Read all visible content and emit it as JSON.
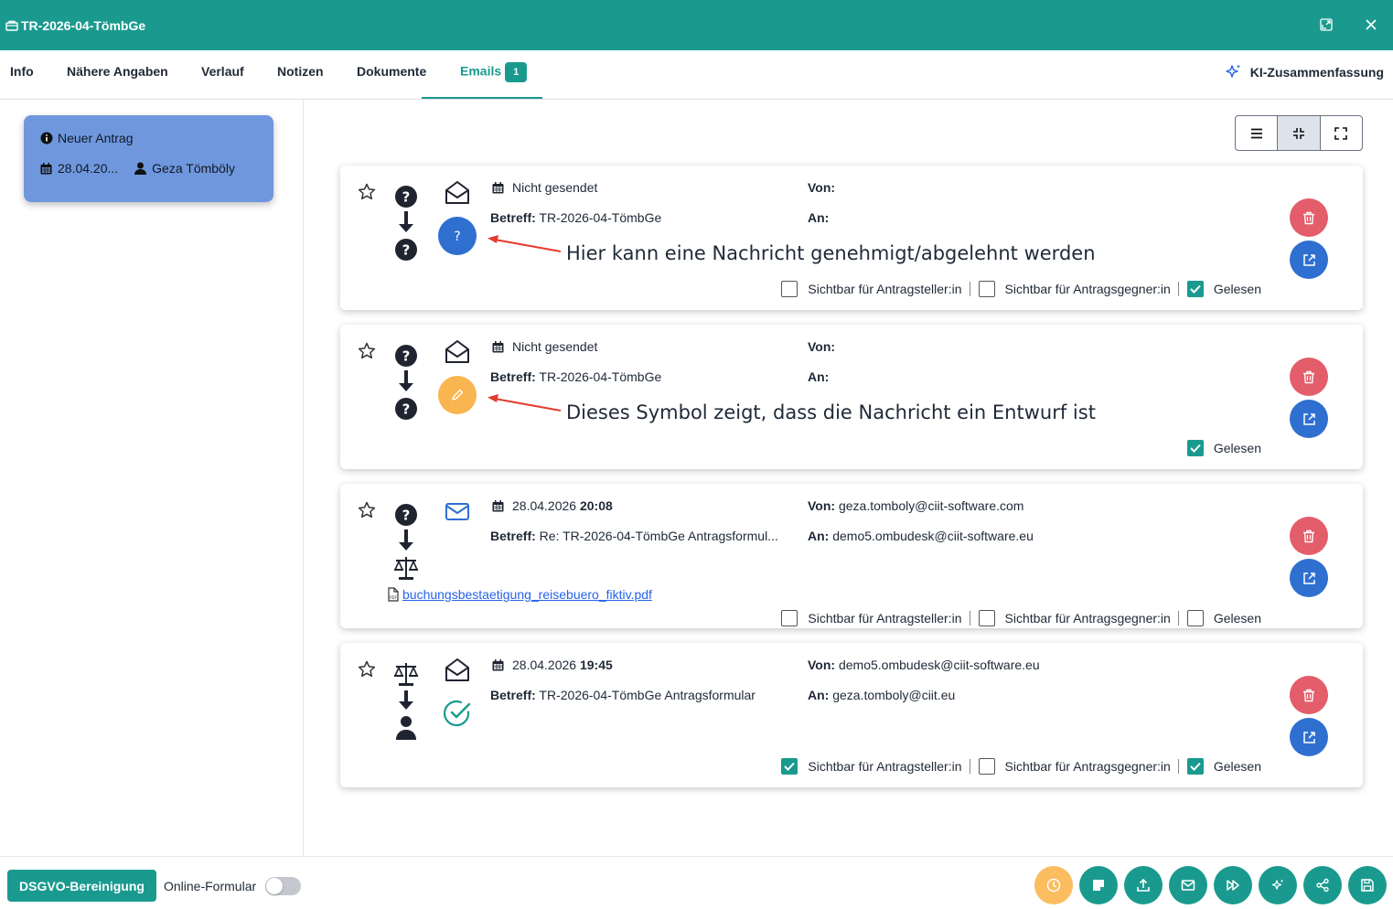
{
  "window": {
    "title": "TR-2026-04-TömbGe"
  },
  "tabs": [
    {
      "label": "Info"
    },
    {
      "label": "Nähere Angaben"
    },
    {
      "label": "Verlauf"
    },
    {
      "label": "Notizen"
    },
    {
      "label": "Dokumente"
    },
    {
      "label": "Emails",
      "badge": "1",
      "active": true
    }
  ],
  "ki_summary": {
    "label": "KI-Zusammenfassung"
  },
  "antrag_card": {
    "status": "Neuer Antrag",
    "date": "28.04.20...",
    "user": "Geza Tömböly"
  },
  "labels": {
    "betreff": "Betreff:",
    "von": "Von:",
    "an": "An:",
    "sichtbar_antragsteller": "Sichtbar für Antragsteller:in",
    "sichtbar_antragsgegner": "Sichtbar für Antragsgegner:in",
    "gelesen": "Gelesen"
  },
  "emails": [
    {
      "date": "Nicht gesendet",
      "time": "",
      "subject": "TR-2026-04-TömbGe",
      "from": "",
      "to": "",
      "status": "pending-approval",
      "annotation": "Hier kann eine Nachricht genehmigt/abgelehnt werden",
      "sichtbar_antragsteller": false,
      "sichtbar_antragsgegner": false,
      "gelesen": true
    },
    {
      "date": "Nicht gesendet",
      "time": "",
      "subject": "TR-2026-04-TömbGe",
      "from": "",
      "to": "",
      "status": "draft",
      "annotation": "Dieses Symbol zeigt, dass die Nachricht ein Entwurf ist",
      "gelesen": true
    },
    {
      "date": "28.04.2026",
      "time": "20:08",
      "subject": "Re: TR-2026-04-TömbGe Antragsformul...",
      "from": "geza.tomboly@ciit-software.com",
      "to": "demo5.ombudesk@ciit-software.eu",
      "attachment": "buchungsbestaetigung_reisebuero_fiktiv.pdf",
      "sichtbar_antragsteller": false,
      "sichtbar_antragsgegner": false,
      "gelesen": false
    },
    {
      "date": "28.04.2026",
      "time": "19:45",
      "subject": "TR-2026-04-TömbGe Antragsformular",
      "from": "demo5.ombudesk@ciit-software.eu",
      "to": "geza.tomboly@ciit.eu",
      "status": "sent",
      "sichtbar_antragsteller": true,
      "sichtbar_antragsgegner": false,
      "gelesen": true
    }
  ],
  "bottom": {
    "dsgvo_label": "DSGVO-Bereinigung",
    "online_formular_label": "Online-Formular",
    "online_formular_on": false
  },
  "colors": {
    "primary": "#1a9a8f",
    "card_blue": "#6f97dd",
    "delete_red": "#e35d6a",
    "open_blue": "#2f6fd0",
    "draft_orange": "#f9b550",
    "timer_orange": "#fbbd5f"
  }
}
